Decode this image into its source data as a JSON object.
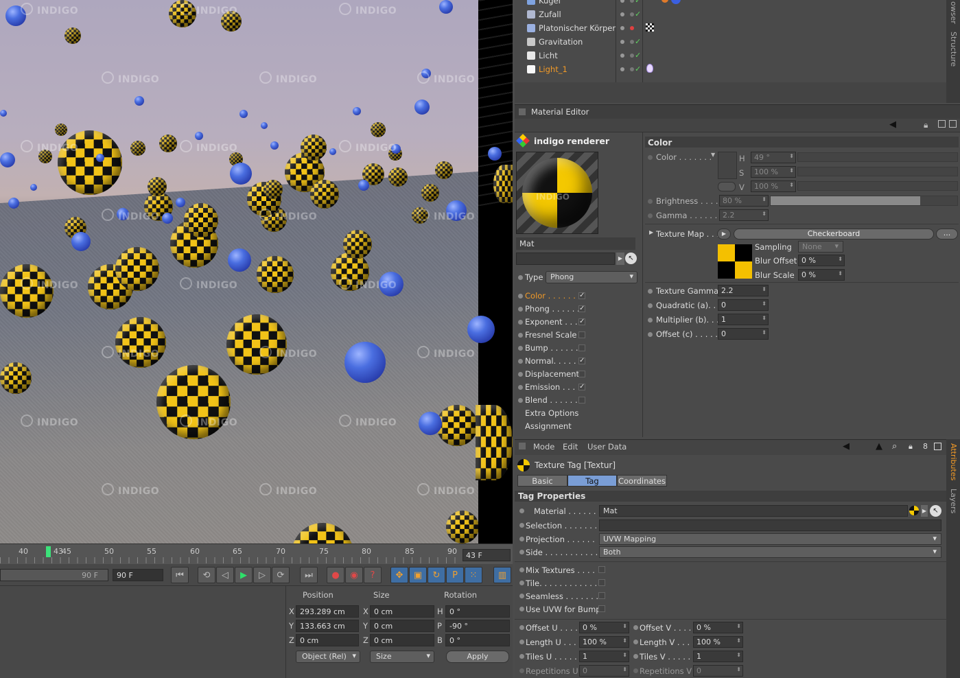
{
  "viewport": {
    "watermark": "INDIGO",
    "timeline_ticks": [
      "40",
      "43",
      "45",
      "50",
      "55",
      "60",
      "65",
      "70",
      "75",
      "80",
      "85",
      "90"
    ],
    "current_frame": "43 F",
    "end_frame_left": "90 F",
    "end_frame_right": "90 F"
  },
  "coords": {
    "headers": {
      "position": "Position",
      "size": "Size",
      "rotation": "Rotation"
    },
    "rows": [
      {
        "axis": "X",
        "pos": "293.289 cm",
        "saxis": "X",
        "size": "0 cm",
        "raxis": "H",
        "rot": "0 °"
      },
      {
        "axis": "Y",
        "pos": "133.663 cm",
        "saxis": "Y",
        "size": "0 cm",
        "raxis": "P",
        "rot": "-90 °"
      },
      {
        "axis": "Z",
        "pos": "0 cm",
        "saxis": "Z",
        "size": "0 cm",
        "raxis": "B",
        "rot": "0 °"
      }
    ],
    "mode_dropdown": "Object (Rel)",
    "size_dropdown": "Size",
    "apply": "Apply"
  },
  "objects": {
    "items": [
      {
        "label": "Kugel"
      },
      {
        "label": "Zufall"
      },
      {
        "label": "Platonischer Körper"
      },
      {
        "label": "Gravitation"
      },
      {
        "label": "Licht"
      },
      {
        "label": "Light_1"
      }
    ],
    "side_tabs": [
      "owser",
      "Structure"
    ]
  },
  "material_editor": {
    "title": "Material Editor",
    "renderer": "indigo renderer",
    "material_name": "Mat",
    "type_label": "Type",
    "type_value": "Phong",
    "channels": [
      {
        "label": "Color . . . . . . .",
        "checked": "✓"
      },
      {
        "label": "Phong . . . . . . .",
        "checked": "✓"
      },
      {
        "label": "Exponent . . . .",
        "checked": "✓"
      },
      {
        "label": "Fresnel Scale",
        "checked": ""
      },
      {
        "label": "Bump . . . . . . .",
        "checked": ""
      },
      {
        "label": "Normal. . . . . .",
        "checked": "✓"
      },
      {
        "label": "Displacement",
        "checked": ""
      },
      {
        "label": "Emission . . . .",
        "checked": "✓"
      },
      {
        "label": "Blend . . . . . . .",
        "checked": ""
      }
    ],
    "extra": "Extra Options",
    "assignment": "Assignment",
    "section": "Color",
    "color_label": "Color . . . . . . .",
    "h_label": "H",
    "h_value": "49 °",
    "s_label": "S",
    "s_value": "100 %",
    "v_label": "V",
    "v_value": "100 %",
    "brightness_label": "Brightness . . . . .",
    "brightness_value": "80 %",
    "brightness_fill": 0.8,
    "gamma_label": "Gamma . . . . . . .",
    "gamma_value": "2.2",
    "texmap_label": "Texture Map . . .",
    "texmap_value": "Checkerboard",
    "more": "...",
    "sampling_label": "Sampling",
    "sampling_value": "None",
    "bluroff_label": "Blur Offset",
    "bluroff_value": "0 %",
    "blurscale_label": "Blur Scale",
    "blurscale_value": "0 %",
    "texgamma_label": "Texture Gamma",
    "texgamma_value": "2.2",
    "quad_label": "Quadratic (a). . .",
    "quad_value": "0",
    "mult_label": "Multiplier (b). . .",
    "mult_value": "1",
    "offc_label": "Offset (c) . . . . . .",
    "offc_value": "0"
  },
  "attributes": {
    "menu": [
      "Mode",
      "Edit",
      "User Data"
    ],
    "title": "Texture Tag [Textur]",
    "tabs": [
      "Basic",
      "Tag",
      "Coordinates"
    ],
    "section": "Tag Properties",
    "material_label": "Material . . . . . . .",
    "material_value": "Mat",
    "selection_label": "Selection . . . . . . . .",
    "projection_label": "Projection . . . . . .",
    "projection_value": "UVW Mapping",
    "side_label": "Side . . . . . . . . . . . .",
    "side_value": "Both",
    "mix_label": "Mix Textures . . . .",
    "tile_label": "Tile. . . . . . . . . . . . .",
    "seamless_label": "Seamless . . . . . . . .",
    "uvwbump_label": "Use UVW for Bump",
    "offu_label": "Offset U . . . . .",
    "offu_value": "0 %",
    "offv_label": "Offset V . . . . .",
    "offv_value": "0 %",
    "lenu_label": "Length U . . . .",
    "lenu_value": "100 %",
    "lenv_label": "Length V . . . .",
    "lenv_value": "100 %",
    "tilesu_label": "Tiles U . . . . . .",
    "tilesu_value": "1",
    "tilesv_label": "Tiles V . . . . . .",
    "tilesv_value": "1",
    "repu_label": "Repetitions U",
    "repu_value": "0",
    "repv_label": "Repetitions V",
    "repv_value": "0",
    "side_tabs": [
      "Attributes",
      "Layers"
    ]
  },
  "colors": {
    "accent": "#f29a27",
    "check": "#5fd15f",
    "play": "#3ce27a",
    "tab_active": "#7a9ed6"
  }
}
